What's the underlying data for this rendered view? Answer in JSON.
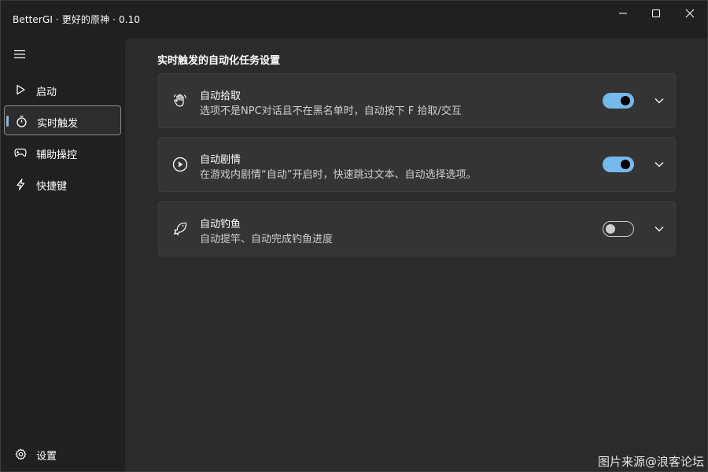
{
  "window": {
    "title": "BetterGI · 更好的原神 · 0.10"
  },
  "sidebar": {
    "items": [
      {
        "label": "启动",
        "icon": "play-outline-icon"
      },
      {
        "label": "实时触发",
        "icon": "timer-icon"
      },
      {
        "label": "辅助操控",
        "icon": "gamepad-icon"
      },
      {
        "label": "快捷键",
        "icon": "flash-icon"
      }
    ],
    "footer": {
      "label": "设置",
      "icon": "gear-icon"
    }
  },
  "main": {
    "section_title": "实时触发的自动化任务设置",
    "cards": [
      {
        "title": "自动拾取",
        "description": "选项不是NPC对话且不在黑名单时，自动按下 F 拾取/交互",
        "enabled": true,
        "icon": "hand-wave-icon"
      },
      {
        "title": "自动剧情",
        "description": "在游戏内剧情“自动”开启时，快速跳过文本、自动选择选项。",
        "enabled": true,
        "icon": "play-circle-icon"
      },
      {
        "title": "自动钓鱼",
        "description": "自动提竿、自动完成钓鱼进度",
        "enabled": false,
        "icon": "fish-icon"
      }
    ]
  },
  "watermark": "图片来源@浪客论坛",
  "colors": {
    "accent": "#76b9ed",
    "background": "#202020",
    "content": "#2b2b2b",
    "card": "#343434"
  }
}
